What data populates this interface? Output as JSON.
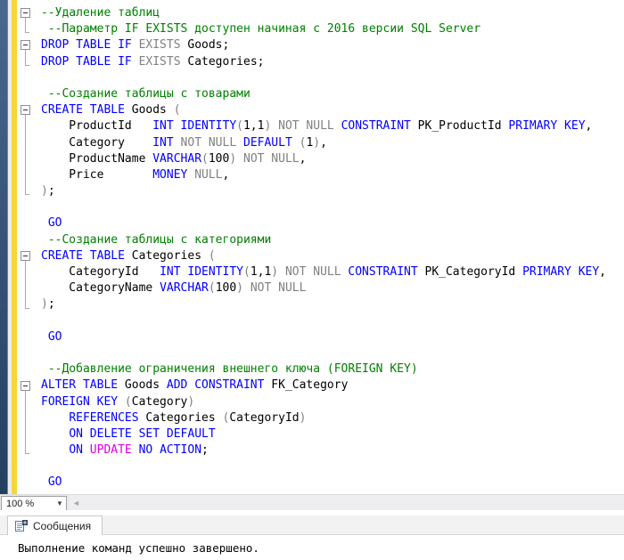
{
  "editor": {
    "zoom_level": "100 %",
    "token_colors": {
      "k": "#0000ff",
      "g": "#808080",
      "c": "#008000",
      "m": "#e000e0",
      "i": "#000000"
    },
    "lines": [
      [
        [
          "c",
          "--Удаление таблиц"
        ]
      ],
      [
        [
          "c",
          " --Параметр IF EXISTS доступен начиная с 2016 версии SQL Server"
        ]
      ],
      [
        [
          "k",
          "DROP TABLE IF "
        ],
        [
          "g",
          "EXISTS "
        ],
        [
          "i",
          "Goods;"
        ]
      ],
      [
        [
          "k",
          "DROP TABLE IF "
        ],
        [
          "g",
          "EXISTS "
        ],
        [
          "i",
          "Categories;"
        ]
      ],
      [],
      [
        [
          "c",
          " --Создание таблицы с товарами"
        ]
      ],
      [
        [
          "k",
          "CREATE TABLE "
        ],
        [
          "i",
          "Goods "
        ],
        [
          "g",
          "("
        ]
      ],
      [
        [
          "i",
          "    ProductId   "
        ],
        [
          "k",
          "INT IDENTITY"
        ],
        [
          "g",
          "("
        ],
        [
          "i",
          "1,1"
        ],
        [
          "g",
          ") "
        ],
        [
          "g",
          "NOT NULL "
        ],
        [
          "k",
          "CONSTRAINT "
        ],
        [
          "i",
          "PK_ProductId "
        ],
        [
          "k",
          "PRIMARY KEY"
        ],
        [
          "i",
          ","
        ]
      ],
      [
        [
          "i",
          "    Category    "
        ],
        [
          "k",
          "INT "
        ],
        [
          "g",
          "NOT NULL "
        ],
        [
          "k",
          "DEFAULT "
        ],
        [
          "g",
          "("
        ],
        [
          "i",
          "1"
        ],
        [
          "g",
          ")"
        ],
        [
          "i",
          ","
        ]
      ],
      [
        [
          "i",
          "    ProductName "
        ],
        [
          "k",
          "VARCHAR"
        ],
        [
          "g",
          "("
        ],
        [
          "i",
          "100"
        ],
        [
          "g",
          ") "
        ],
        [
          "g",
          "NOT NULL"
        ],
        [
          "i",
          ","
        ]
      ],
      [
        [
          "i",
          "    Price       "
        ],
        [
          "k",
          "MONEY "
        ],
        [
          "g",
          "NULL"
        ],
        [
          "i",
          ","
        ]
      ],
      [
        [
          "g",
          ")"
        ],
        [
          "i",
          ";"
        ]
      ],
      [],
      [
        [
          "k",
          " GO"
        ]
      ],
      [
        [
          "c",
          " --Создание таблицы с категориями"
        ]
      ],
      [
        [
          "k",
          "CREATE TABLE "
        ],
        [
          "i",
          "Categories "
        ],
        [
          "g",
          "("
        ]
      ],
      [
        [
          "i",
          "    CategoryId   "
        ],
        [
          "k",
          "INT IDENTITY"
        ],
        [
          "g",
          "("
        ],
        [
          "i",
          "1,1"
        ],
        [
          "g",
          ") "
        ],
        [
          "g",
          "NOT NULL "
        ],
        [
          "k",
          "CONSTRAINT "
        ],
        [
          "i",
          "PK_CategoryId "
        ],
        [
          "k",
          "PRIMARY KEY"
        ],
        [
          "i",
          ","
        ]
      ],
      [
        [
          "i",
          "    CategoryName "
        ],
        [
          "k",
          "VARCHAR"
        ],
        [
          "g",
          "("
        ],
        [
          "i",
          "100"
        ],
        [
          "g",
          ") "
        ],
        [
          "g",
          "NOT NULL"
        ]
      ],
      [
        [
          "g",
          ")"
        ],
        [
          "i",
          ";"
        ]
      ],
      [],
      [
        [
          "k",
          " GO"
        ]
      ],
      [],
      [
        [
          "c",
          " --Добавление ограничения внешнего ключа (FOREIGN KEY)"
        ]
      ],
      [
        [
          "k",
          "ALTER TABLE "
        ],
        [
          "i",
          "Goods "
        ],
        [
          "k",
          "ADD CONSTRAINT "
        ],
        [
          "i",
          "FK_Category"
        ]
      ],
      [
        [
          "k",
          "FOREIGN KEY "
        ],
        [
          "g",
          "("
        ],
        [
          "i",
          "Category"
        ],
        [
          "g",
          ")"
        ]
      ],
      [
        [
          "i",
          "    "
        ],
        [
          "k",
          "REFERENCES "
        ],
        [
          "i",
          "Categories "
        ],
        [
          "g",
          "("
        ],
        [
          "i",
          "CategoryId"
        ],
        [
          "g",
          ")"
        ]
      ],
      [
        [
          "i",
          "    "
        ],
        [
          "k",
          "ON DELETE SET DEFAULT"
        ]
      ],
      [
        [
          "i",
          "    "
        ],
        [
          "k",
          "ON "
        ],
        [
          "m",
          "UPDATE "
        ],
        [
          "k",
          "NO ACTION"
        ],
        [
          "i",
          ";"
        ]
      ],
      [],
      [
        [
          "k",
          " GO"
        ]
      ]
    ],
    "folds": [
      {
        "start": 1,
        "end": 2
      },
      {
        "start": 3,
        "end": 4
      },
      {
        "start": 7,
        "end": 12
      },
      {
        "start": 16,
        "end": 19
      },
      {
        "start": 24,
        "end": 28
      }
    ]
  },
  "scrollbar": {
    "left_arrow": "◄"
  },
  "combo": {
    "arrow": "▼"
  },
  "messages": {
    "tab_label": "Сообщения",
    "output": "Выполнение команд успешно завершено."
  },
  "colors": {
    "change_bar": "#f6d635",
    "indicator_strip": "#3a567d",
    "comment": "#008000",
    "keyword": "#0000ff",
    "operator_gray": "#808080",
    "system_magenta": "#e000e0"
  }
}
